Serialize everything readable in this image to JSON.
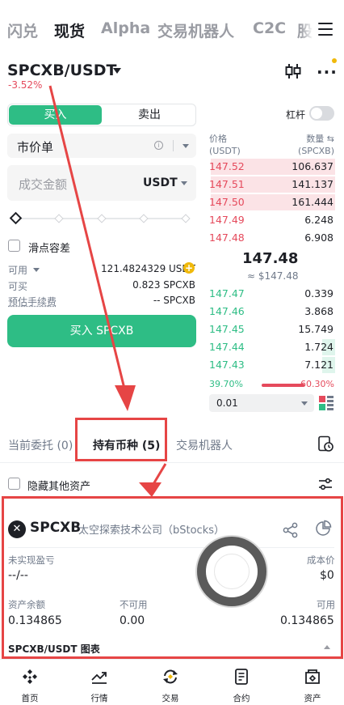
{
  "top_tabs": [
    "闪兑",
    "现货",
    "Alpha",
    "交易机器人",
    "C2C",
    "股"
  ],
  "pair": {
    "symbol": "SPCXB/USDT",
    "change": "-3.52%"
  },
  "trade": {
    "buy_label": "买入",
    "sell_label": "卖出",
    "leverage_label": "杠杆",
    "order_type": "市价单",
    "amount_placeholder": "成交金额",
    "amount_currency": "USDT",
    "slippage_label": "滑点容差",
    "available_label": "可用",
    "available_value": "121.4824329 USDT",
    "buyable_label": "可买",
    "buyable_value": "0.823 SPCXB",
    "fee_label": "预估手续费",
    "fee_value": "-- SPCXB",
    "submit_label": "买入 SPCXB"
  },
  "orderbook": {
    "price_header": "价格",
    "price_unit": "(USDT)",
    "qty_header": "数量",
    "qty_unit": "(SPCXB)",
    "asks": [
      {
        "price": "147.52",
        "qty": "106.637",
        "depth": 0.96
      },
      {
        "price": "147.51",
        "qty": "141.137",
        "depth": 0.96
      },
      {
        "price": "147.50",
        "qty": "161.444",
        "depth": 0.96
      },
      {
        "price": "147.49",
        "qty": "6.248",
        "depth": 0
      },
      {
        "price": "147.48",
        "qty": "6.908",
        "depth": 0
      }
    ],
    "last_price": "147.48",
    "last_price_usd": "≈ $147.48",
    "bids": [
      {
        "price": "147.47",
        "qty": "0.339",
        "depth": 0
      },
      {
        "price": "147.46",
        "qty": "3.868",
        "depth": 0
      },
      {
        "price": "147.45",
        "qty": "15.749",
        "depth": 0
      },
      {
        "price": "147.44",
        "qty": "1.724",
        "depth": 0.1
      },
      {
        "price": "147.43",
        "qty": "7.121",
        "depth": 0.1
      }
    ],
    "buy_ratio": "39.70%",
    "sell_ratio": "60.30%",
    "buy_ratio_value": 39.7,
    "depth_step": "0.01"
  },
  "bottom_tabs": {
    "open_orders": "当前委托 (0)",
    "holdings": "持有币种",
    "holdings_count": "(5)",
    "bots": "交易机器人"
  },
  "hide_other_label": "隐藏其他资产",
  "holding": {
    "coin": "SPCXB",
    "full_name": "太空探索技术公司（bStocks）",
    "pnl_label": "未实现盈亏",
    "pnl_value": "--/--",
    "cost_label": "成本价",
    "cost_value": "$0",
    "balance_label": "资产余额",
    "balance_value": "0.134865",
    "unavailable_label": "不可用",
    "unavailable_value": "0.00",
    "available_label": "可用",
    "available_value": "0.134865",
    "chart_title": "SPCXB/USDT 图表"
  },
  "nav": [
    "首页",
    "行情",
    "交易",
    "合约",
    "资产"
  ],
  "colors": {
    "up": "#2ebd85",
    "down": "#e54a5c",
    "annotation": "#e64545",
    "accent": "#f0b90b"
  }
}
